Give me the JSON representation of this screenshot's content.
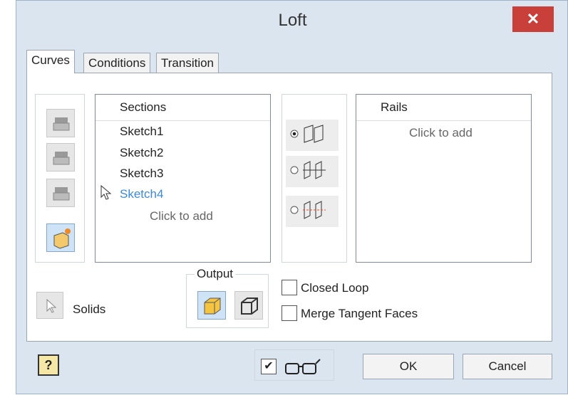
{
  "window": {
    "title": "Loft",
    "close_label": "✕"
  },
  "tabs": [
    {
      "label": "Curves"
    },
    {
      "label": "Conditions"
    },
    {
      "label": "Transition"
    }
  ],
  "sections": {
    "header": "Sections",
    "items": [
      "Sketch1",
      "Sketch2",
      "Sketch3",
      "Sketch4"
    ],
    "click_to_add": "Click to add"
  },
  "rails": {
    "header": "Rails",
    "click_to_add": "Click to add"
  },
  "output": {
    "label": "Output"
  },
  "solids": {
    "label": "Solids"
  },
  "options": {
    "closed_loop": "Closed Loop",
    "merge_tangent_faces": "Merge Tangent Faces"
  },
  "footer": {
    "ok_label": "OK",
    "cancel_label": "Cancel",
    "help_label": "?",
    "preview_checked": "✔"
  },
  "colors": {
    "accent_blue": "#3b8ad9",
    "close_red": "#c9403a"
  }
}
